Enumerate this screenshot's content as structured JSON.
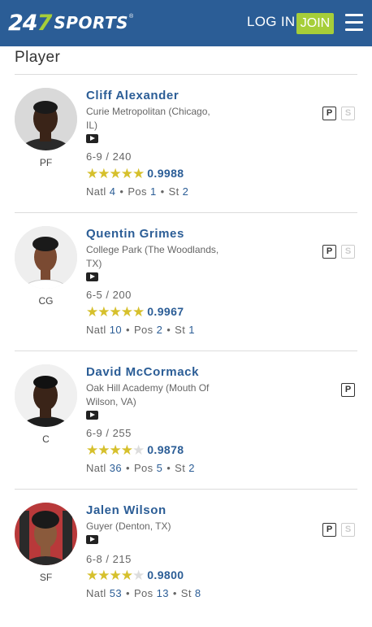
{
  "header": {
    "logo_num_a": "24",
    "logo_num_b": "7",
    "logo_word": "SPORTS",
    "logo_tm": "®",
    "login": "LOG IN",
    "join": "JOIN"
  },
  "section_title": "Player",
  "colors": {
    "brand_blue": "#2b5d96",
    "join_green": "#a6ce39",
    "star_gold": "#d6c02c"
  },
  "players": [
    {
      "name": "Cliff Alexander",
      "school": "Curie Metropolitan (Chicago, IL)",
      "pos": "PF",
      "hw": "6-9 / 240",
      "stars": 5,
      "score": "0.9988",
      "natl_label": "Natl",
      "natl": "4",
      "pos_label": "Pos",
      "pos_rank": "1",
      "st_label": "St",
      "st": "2",
      "badges": [
        "P",
        "S"
      ]
    },
    {
      "name": "Quentin Grimes",
      "school": "College Park (The Woodlands, TX)",
      "pos": "CG",
      "hw": "6-5 / 200",
      "stars": 5,
      "score": "0.9967",
      "natl_label": "Natl",
      "natl": "10",
      "pos_label": "Pos",
      "pos_rank": "2",
      "st_label": "St",
      "st": "1",
      "badges": [
        "P",
        "S"
      ]
    },
    {
      "name": "David McCormack",
      "school": "Oak Hill Academy (Mouth Of Wilson, VA)",
      "pos": "C",
      "hw": "6-9 / 255",
      "stars": 4,
      "score": "0.9878",
      "natl_label": "Natl",
      "natl": "36",
      "pos_label": "Pos",
      "pos_rank": "5",
      "st_label": "St",
      "st": "2",
      "badges": [
        "P"
      ]
    },
    {
      "name": "Jalen Wilson",
      "school": "Guyer (Denton, TX)",
      "pos": "SF",
      "hw": "6-8 / 215",
      "stars": 4,
      "score": "0.9800",
      "natl_label": "Natl",
      "natl": "53",
      "pos_label": "Pos",
      "pos_rank": "13",
      "st_label": "St",
      "st": "8",
      "badges": [
        "P",
        "S"
      ]
    }
  ]
}
